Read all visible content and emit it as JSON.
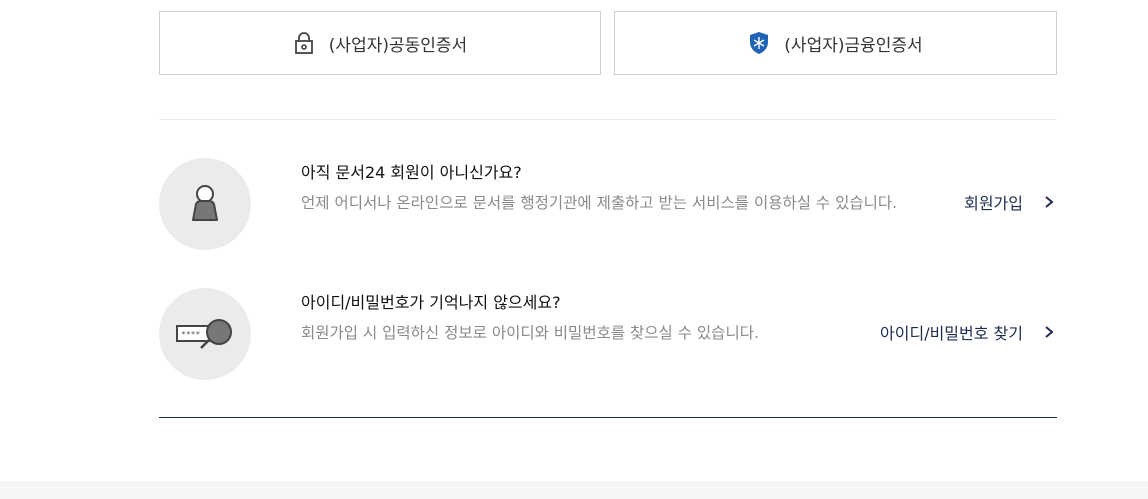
{
  "certificates": {
    "joint": {
      "label": "(사업자)공동인증서",
      "icon": "lock-icon"
    },
    "financial": {
      "label": "(사업자)금융인증서",
      "icon": "shield-icon"
    }
  },
  "signup": {
    "title": "아직 문서24 회원이 아니신가요?",
    "description": "언제 어디서나 온라인으로 문서를 행정기관에 제출하고 받는 서비스를 이용하실 수 있습니다.",
    "link_label": "회원가입",
    "icon": "person-icon"
  },
  "find_account": {
    "title": "아이디/비밀번호가 기억나지 않으세요?",
    "description": "회원가입 시 입력하신 정보로 아이디와 비밀번호를 찾으실 수 있습니다.",
    "link_label": "아이디/비밀번호 찾기",
    "icon": "password-search-icon"
  },
  "colors": {
    "link": "#1e2d4d",
    "circle_bg": "#ebebeb",
    "shield": "#1f63b5"
  }
}
